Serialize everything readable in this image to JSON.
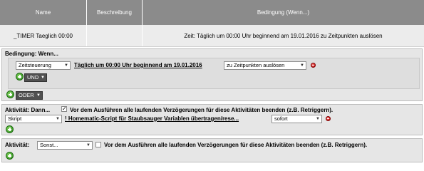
{
  "table": {
    "headers": [
      "Name",
      "Beschreibung",
      "Bedingung (Wenn...)"
    ],
    "row": {
      "name": "_TIMER Taeglich 00:00",
      "beschreibung": "",
      "bedingung": "Zeit: Täglich um 00:00 Uhr beginnend am 19.01.2016 zu Zeitpunkten auslösen"
    }
  },
  "condition": {
    "title": "Bedingung: Wenn...",
    "type_select": "Zeitsteuerung",
    "time_link": "Täglich um 00:00 Uhr beginnend am 19.01.2016",
    "trigger_select": "zu Zeitpunkten auslösen",
    "und_select": "UND",
    "oder_select": "ODER"
  },
  "activity_then": {
    "title": "Aktivität: Dann...",
    "checkbox_label": "Vor dem Ausführen alle laufenden Verzögerungen für diese Aktivitäten beenden (z.B. Retriggern).",
    "type_select": "Skript",
    "script_link": "! Homematic-Script für Staubsauger Variablen übertragen/rese...",
    "timing_select": "sofort"
  },
  "activity_else": {
    "title": "Aktivität:",
    "select": "Sonst...",
    "checkbox_label": "Vor dem Ausführen alle laufenden Verzögerungen für diese Aktivitäten beenden (z.B. Retriggern)."
  },
  "colors": {
    "header_bg": "#8b8b8b",
    "section_bg": "#e6e6e6",
    "delete_red": "#c00000",
    "add_green": "#2e8b1f"
  },
  "icons": {
    "add": "plus-circle-icon",
    "delete": "delete-circle-icon",
    "dropdown": "chevron-down-icon",
    "check": "check-icon"
  }
}
